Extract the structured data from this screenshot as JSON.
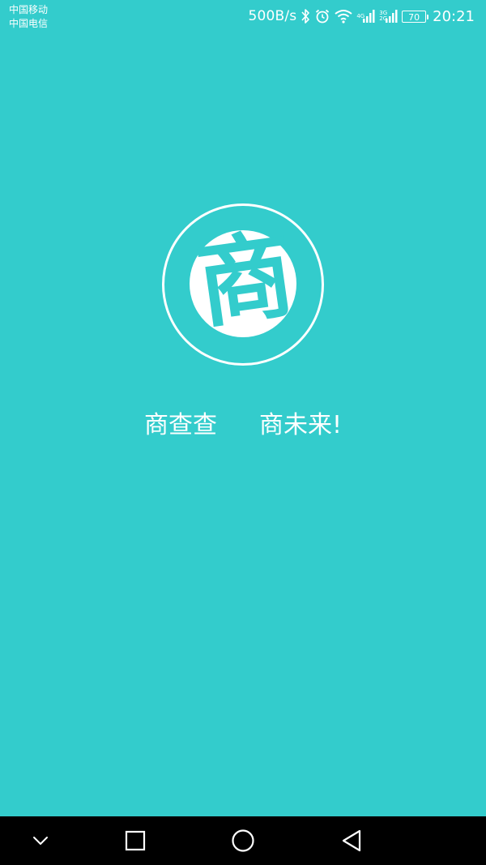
{
  "status_bar": {
    "carrier_1": "中国移动",
    "carrier_2": "中国电信",
    "net_speed": "500B/s",
    "network_4g_label": "4G",
    "network_3g_label": "3G",
    "network_2g_label": "2G",
    "battery_level": "70",
    "time": "20:21",
    "icons": [
      "bluetooth-icon",
      "alarm-icon",
      "wifi-icon",
      "signal-icon",
      "battery-icon"
    ]
  },
  "splash": {
    "logo_char": "商",
    "slogan_left": "商查查",
    "slogan_right": "商未来!"
  },
  "nav_bar": {
    "buttons": [
      "hide-keyboard-icon",
      "recents-icon",
      "home-icon",
      "back-icon"
    ]
  },
  "colors": {
    "background": "#33CCCC",
    "foreground": "#FFFFFF",
    "nav_bar": "#000000"
  }
}
